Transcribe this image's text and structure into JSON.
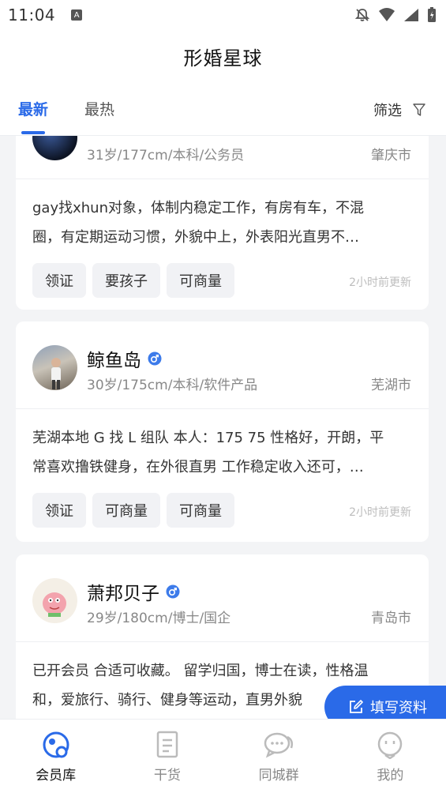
{
  "status": {
    "time": "11:04",
    "indicator": "A"
  },
  "header": {
    "title": "形婚星球"
  },
  "tabs": [
    {
      "label": "最新"
    },
    {
      "label": "最热"
    }
  ],
  "filter": {
    "label": "筛选"
  },
  "cards": [
    {
      "name": "",
      "meta": "31岁/177cm/本科/公务员",
      "city": "肇庆市",
      "desc_lines": [
        "gay找xhun对象，体制内稳定工作，有房有车，不混",
        "圈，有定期运动习惯，外貌中上，外表阳光直男不…"
      ],
      "tags": [
        "领证",
        "要孩子",
        "可商量"
      ],
      "updated": "2小时前更新"
    },
    {
      "name": "鲸鱼岛",
      "meta": "30岁/175cm/本科/软件产品",
      "city": "芜湖市",
      "desc_lines": [
        "芜湖本地 G 找 L 组队 本人：175 75 性格好，开朗，平",
        "常喜欢撸铁健身，在外很直男 工作稳定收入还可，…"
      ],
      "tags": [
        "领证",
        "可商量",
        "可商量"
      ],
      "updated": "2小时前更新"
    },
    {
      "name": "萧邦贝子",
      "meta": "29岁/180cm/博士/国企",
      "city": "青岛市",
      "desc_lines": [
        "已开会员 合适可收藏。 留学归国，博士在读，性格温",
        "和，爱旅行、骑行、健身等运动，直男外貌"
      ],
      "tags": [],
      "updated": ""
    }
  ],
  "fab": {
    "label": "填写资料"
  },
  "nav": [
    {
      "label": "会员库"
    },
    {
      "label": "干货"
    },
    {
      "label": "同城群"
    },
    {
      "label": "我的"
    }
  ],
  "colors": {
    "accent": "#2a6ae8",
    "bg": "#f3f4f6"
  }
}
